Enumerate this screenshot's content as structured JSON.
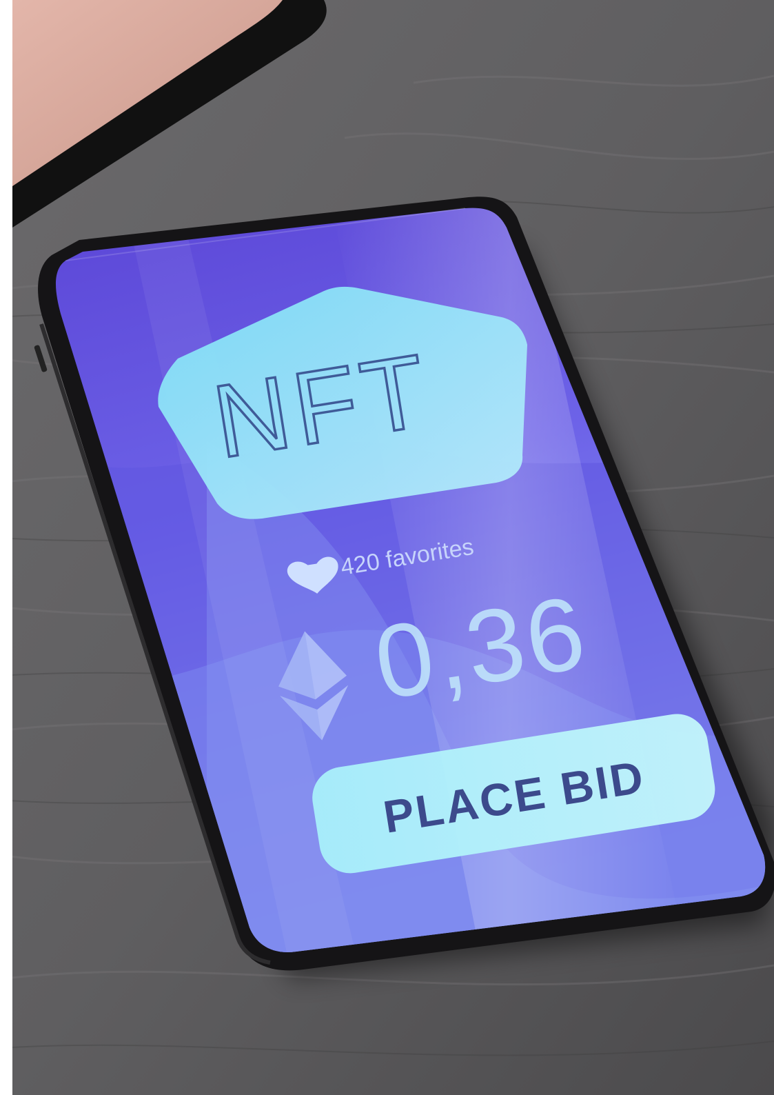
{
  "app": {
    "logo_text": "NFT",
    "favorites_text": "420 favorites",
    "price_value": "0,36",
    "currency_icon": "ethereum-icon",
    "favorite_icon": "heart-icon",
    "bid_button_label": "PLACE BID"
  },
  "colors": {
    "screen_top": "#5a48d8",
    "screen_bottom": "#8fa4f6",
    "accent_cyan": "#a9f3fa",
    "text_dark": "#3c4a8c",
    "text_light": "#c9d6fb",
    "table_wood": "#5e5d5f",
    "laptop_pink": "#d8a99c"
  }
}
